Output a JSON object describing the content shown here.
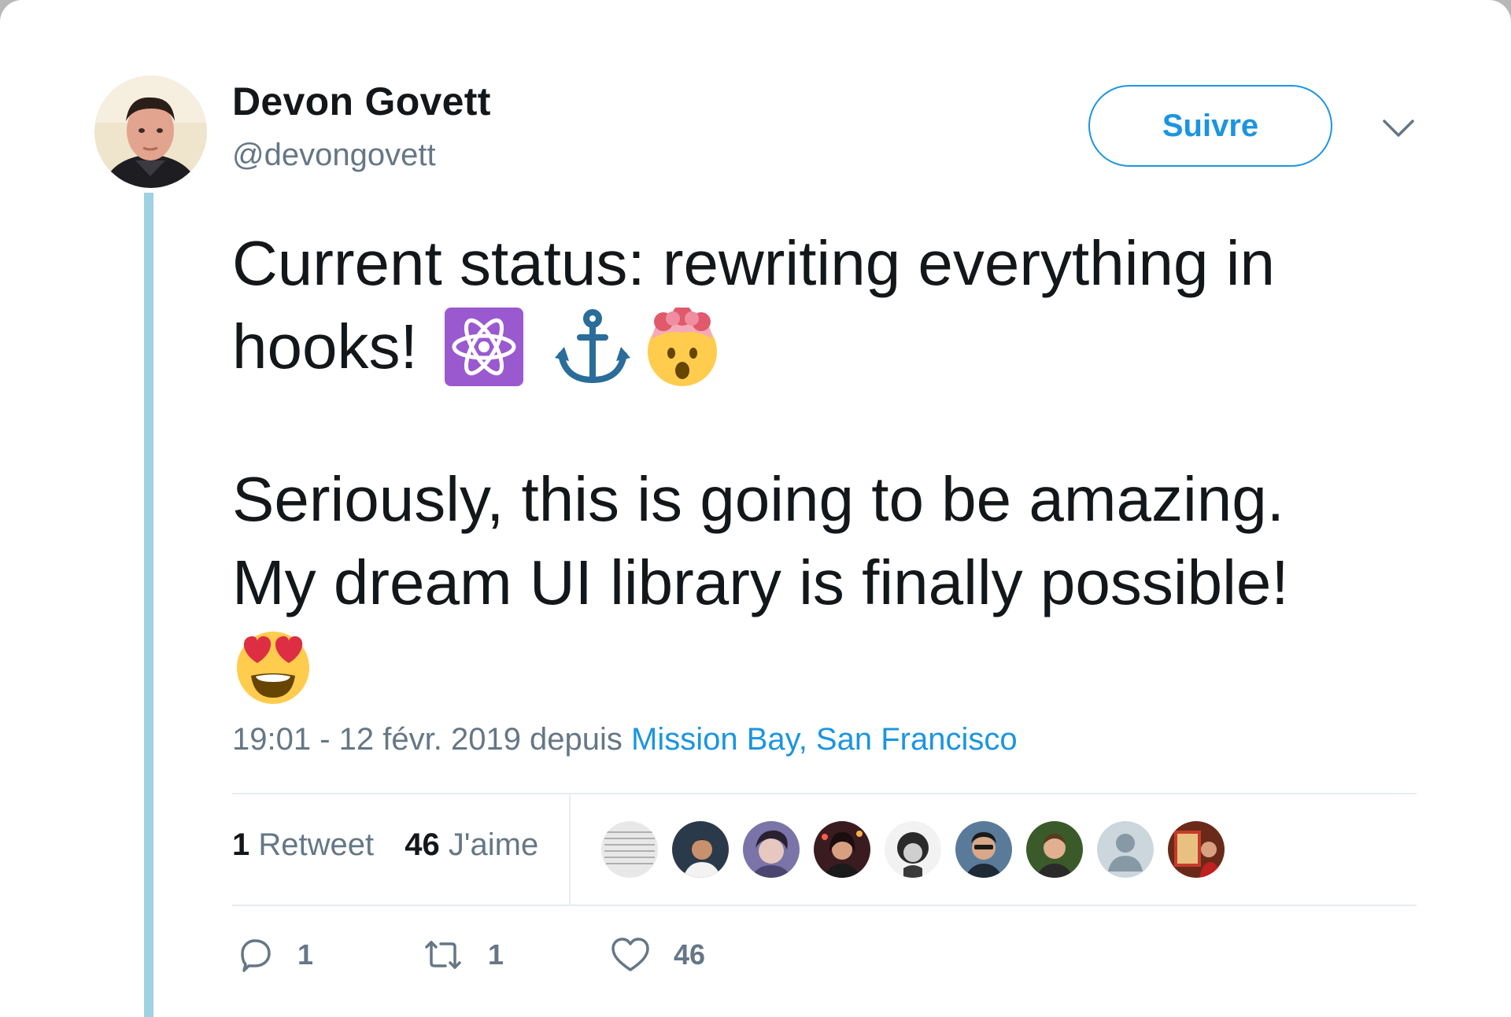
{
  "author": {
    "name": "Devon Govett",
    "handle": "@devongovett"
  },
  "follow_button_label": "Suivre",
  "tweet": {
    "line1": "Current status: rewriting everything in",
    "line2": "hooks!",
    "line3": "Seriously, this is going to be amazing.",
    "line4": "My dream UI library is finally possible!",
    "emojis": [
      "atom-symbol-emoji",
      "anchor-emoji",
      "exploding-head-emoji",
      "heart-eyes-emoji"
    ]
  },
  "meta": {
    "time_date": "19:01 - 12 févr. 2019 depuis",
    "place": "Mission Bay, San Francisco"
  },
  "stats": {
    "retweets_count": "1",
    "retweets_label": "Retweet",
    "likes_count": "46",
    "likes_label": "J'aime"
  },
  "actions": {
    "reply_count": "1",
    "retweet_count": "1",
    "like_count": "46"
  },
  "colors": {
    "accent": "#1b95e0",
    "text": "#14171a",
    "muted": "#657786",
    "thread_line": "#9fd2e2",
    "atom_tile": "#9b59d0"
  }
}
